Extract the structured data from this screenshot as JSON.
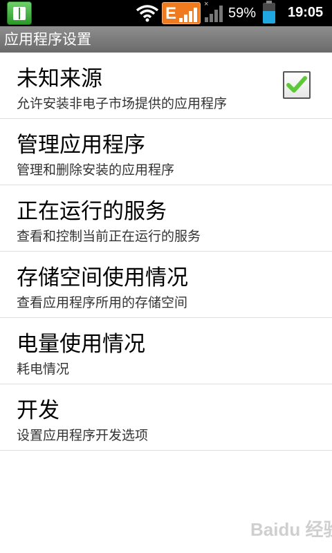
{
  "status_bar": {
    "network_badge": "E",
    "no_signal_mark": "×",
    "battery_percent": "59%",
    "battery_level": 0.59,
    "time": "19:05",
    "icons": [
      "app-icon",
      "wifi-icon",
      "edge-network-icon",
      "signal-icon",
      "battery-icon"
    ]
  },
  "title": "应用程序设置",
  "items": [
    {
      "title": "未知来源",
      "subtitle": "允许安装非电子市场提供的应用程序",
      "checked": true
    },
    {
      "title": "管理应用程序",
      "subtitle": "管理和删除安装的应用程序"
    },
    {
      "title": "正在运行的服务",
      "subtitle": "查看和控制当前正在运行的服务"
    },
    {
      "title": "存储空间使用情况",
      "subtitle": "查看应用程序所用的存储空间"
    },
    {
      "title": "电量使用情况",
      "subtitle": "耗电情况"
    },
    {
      "title": "开发",
      "subtitle": "设置应用程序开发选项"
    }
  ],
  "watermark": "Baidu 经验",
  "colors": {
    "check": "#5fc83a",
    "network_badge": "#f07a1e",
    "battery_fill": "#1ea7e0",
    "title_bar": "#7a7a7a"
  }
}
